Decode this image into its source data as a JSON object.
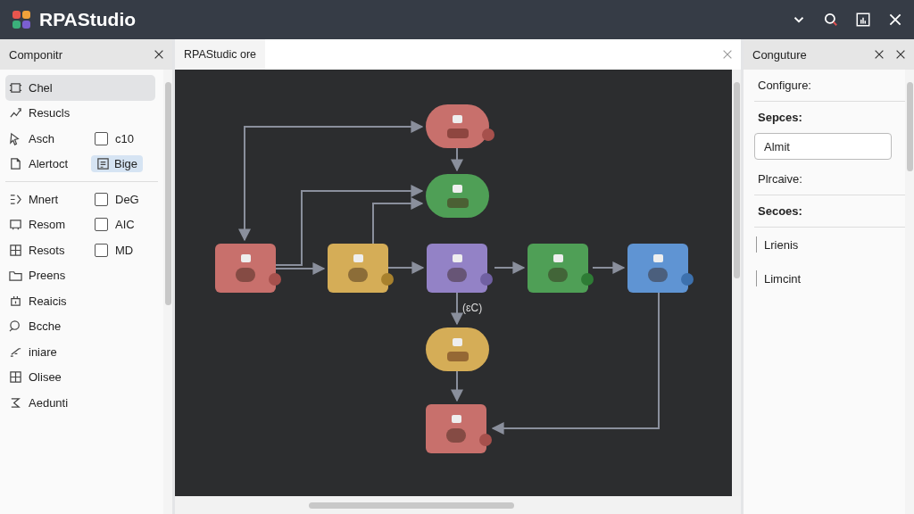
{
  "window": {
    "title": "RPAStudio"
  },
  "components_panel": {
    "title": "Componitr",
    "groups": [
      {
        "rows": [
          {
            "label": "Chel",
            "selected": true
          },
          {
            "label": "Resucls",
            "selected": false
          },
          {
            "label": "Asch",
            "selected": false,
            "option": {
              "kind": "checkbox",
              "label": "c10",
              "checked": false
            }
          },
          {
            "label": "Alertoct",
            "selected": false,
            "option": {
              "kind": "chip",
              "label": "Bige",
              "selected": true
            }
          }
        ]
      },
      {
        "rows": [
          {
            "label": "Mnert",
            "selected": false,
            "option": {
              "kind": "checkbox",
              "label": "DeG",
              "checked": false
            }
          },
          {
            "label": "Resom",
            "selected": false,
            "option": {
              "kind": "checkbox",
              "label": "AIC",
              "checked": false
            }
          },
          {
            "label": "Resots",
            "selected": false,
            "option": {
              "kind": "checkbox",
              "label": "MD",
              "checked": false
            }
          },
          {
            "label": "Preens",
            "selected": false
          },
          {
            "label": "Reaicis",
            "selected": false
          },
          {
            "label": "Bcche",
            "selected": false
          },
          {
            "label": "iniare",
            "selected": false
          },
          {
            "label": "Olisee",
            "selected": false
          },
          {
            "label": "Aedunti",
            "selected": false
          }
        ]
      }
    ]
  },
  "editor": {
    "tab": "RPAStudic ore",
    "edge_label": "(ɛC)",
    "nodes": [
      {
        "kind": "oval",
        "color": "#c8706c",
        "port": true
      },
      {
        "kind": "oval",
        "color": "#4f9f56",
        "port": false
      },
      {
        "kind": "box",
        "color": "#c8706c",
        "port": true
      },
      {
        "kind": "box",
        "color": "#d5ad57",
        "port": true
      },
      {
        "kind": "box",
        "color": "#9382c6",
        "port": true
      },
      {
        "kind": "box",
        "color": "#4f9f56",
        "port": true
      },
      {
        "kind": "box",
        "color": "#5f94d3",
        "port": true
      },
      {
        "kind": "oval",
        "color": "#d5ad57",
        "port": false
      },
      {
        "kind": "box",
        "color": "#c8706c",
        "port": true
      }
    ]
  },
  "configure_panel": {
    "title": "Conguture",
    "heading": "Configure:",
    "section_1": "Sepces:",
    "input": {
      "value": "Almit"
    },
    "field_label": "Plrcaive:",
    "section_2": "Secoes:",
    "tree": [
      {
        "label": "Lrienis"
      },
      {
        "label": "Limcint"
      }
    ]
  }
}
